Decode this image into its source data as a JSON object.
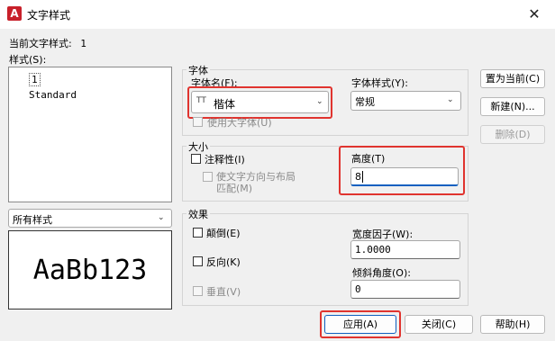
{
  "window": {
    "title": "文字样式",
    "app_icon": "A"
  },
  "current_style": {
    "label": "当前文字样式:",
    "value": "1"
  },
  "styles": {
    "label": "样式(S):",
    "items": [
      "1",
      "Standard"
    ]
  },
  "filter": {
    "selected": "所有样式"
  },
  "preview": {
    "text": "AaBb123"
  },
  "font": {
    "group_label": "字体",
    "name_label": "字体名(F):",
    "name_value": "楷体",
    "tt_icon": "TT",
    "style_label": "字体样式(Y):",
    "style_value": "常规",
    "big_font_label": "使用大字体(U)"
  },
  "size": {
    "group_label": "大小",
    "annotative_label": "注释性(I)",
    "match_line1": "使文字方向与布局",
    "match_line2": "匹配(M)",
    "height_label": "高度(T)",
    "height_value": "8"
  },
  "effects": {
    "group_label": "效果",
    "upside_down": "颠倒(E)",
    "backwards": "反向(K)",
    "vertical": "垂直(V)",
    "width_factor_label": "宽度因子(W):",
    "width_factor_value": "1.0000",
    "oblique_label": "倾斜角度(O):",
    "oblique_value": "0"
  },
  "buttons": {
    "set_current": "置为当前(C)",
    "new": "新建(N)...",
    "delete": "删除(D)",
    "apply": "应用(A)",
    "close": "关闭(C)",
    "help": "帮助(H)"
  },
  "icons": {
    "close": "close-icon",
    "dropdown": "chevron-down-icon",
    "truetype": "truetype-icon"
  },
  "colors": {
    "highlight": "#e0342f",
    "app_icon": "#c8202a"
  }
}
